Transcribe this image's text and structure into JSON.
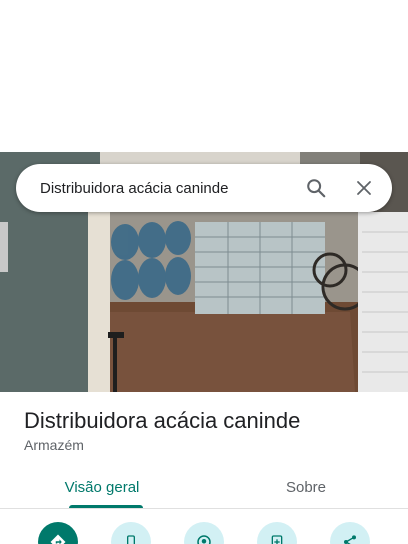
{
  "search": {
    "query": "Distribuidora acácia caninde",
    "search_icon": "search-icon",
    "close_icon": "close-icon"
  },
  "place": {
    "name": "Distribuidora acácia caninde",
    "category": "Armazém",
    "photo": "storefront-photo"
  },
  "tabs": [
    {
      "label": "Visão geral",
      "active": true
    },
    {
      "label": "Sobre",
      "active": false
    }
  ],
  "actions": [
    {
      "icon": "directions-icon"
    },
    {
      "icon": "phone-icon"
    },
    {
      "icon": "location-share-icon"
    },
    {
      "icon": "save-icon"
    },
    {
      "icon": "share-icon"
    }
  ],
  "colors": {
    "accent": "#00796b",
    "action_bg": "#d2f0f4",
    "title": "#202124",
    "secondary_text": "#5f6368"
  }
}
